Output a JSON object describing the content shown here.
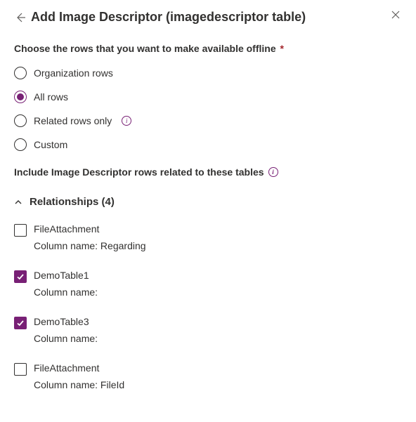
{
  "header": {
    "title": "Add Image Descriptor (imagedescriptor table)"
  },
  "prompt": {
    "text": "Choose the rows that you want to make available offline",
    "required_mark": "*"
  },
  "row_options": [
    {
      "label": "Organization rows",
      "selected": false,
      "has_info": false
    },
    {
      "label": "All rows",
      "selected": true,
      "has_info": false
    },
    {
      "label": "Related rows only",
      "selected": false,
      "has_info": true
    },
    {
      "label": "Custom",
      "selected": false,
      "has_info": false
    }
  ],
  "related_tables_heading": "Include Image Descriptor rows related to these tables",
  "relationships": {
    "label": "Relationships",
    "count": 4,
    "items": [
      {
        "name": "FileAttachment",
        "column_name_label": "Column name:",
        "column_name_value": "Regarding",
        "checked": false
      },
      {
        "name": "DemoTable1",
        "column_name_label": "Column name:",
        "column_name_value": "",
        "checked": true
      },
      {
        "name": "DemoTable3",
        "column_name_label": "Column name:",
        "column_name_value": "",
        "checked": true
      },
      {
        "name": "FileAttachment",
        "column_name_label": "Column name:",
        "column_name_value": "FileId",
        "checked": false
      }
    ]
  },
  "colors": {
    "accent": "#782075"
  }
}
